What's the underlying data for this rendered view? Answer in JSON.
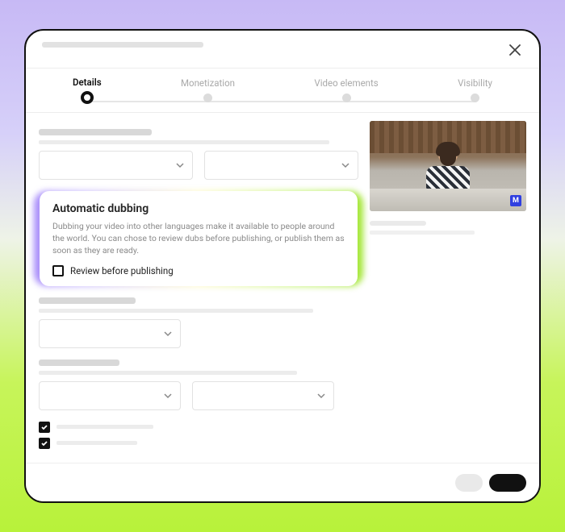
{
  "stepper": {
    "steps": [
      {
        "label": "Details",
        "active": true
      },
      {
        "label": "Monetization",
        "active": false
      },
      {
        "label": "Video elements",
        "active": false
      },
      {
        "label": "Visibility",
        "active": false
      }
    ]
  },
  "highlight": {
    "title": "Automatic dubbing",
    "description": "Dubbing your video into other languages make it available to people around the world. You can chose to review dubs before publishing, or publish them as soon as they are ready.",
    "checkbox_label": "Review before publishing",
    "checkbox_checked": false
  },
  "thumbnail": {
    "badge": "M"
  },
  "checklist": {
    "item1_checked": true,
    "item2_checked": true
  }
}
